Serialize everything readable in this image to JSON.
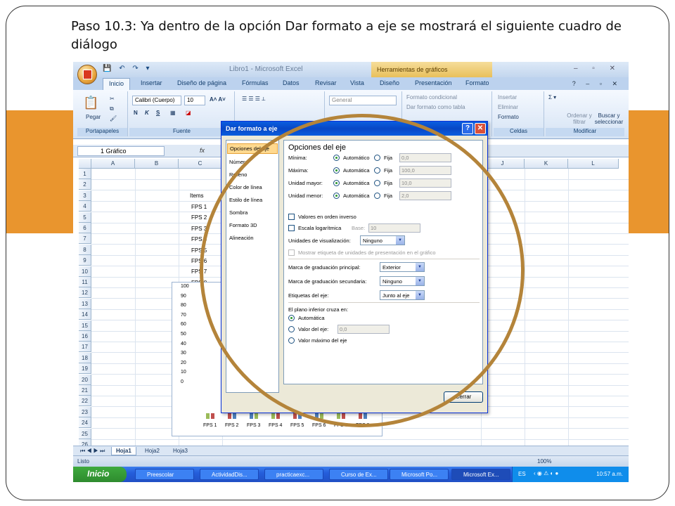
{
  "slide": {
    "title": "Paso 10.3: Ya dentro de la opción Dar formato a eje se mostrará el siguiente cuadro de diálogo",
    "accent_color": "#e9952e",
    "ring_color": "#b4843a"
  },
  "excel": {
    "window_title": "Libro1 - Microsoft Excel",
    "tools_tab": "Herramientas de gráficos",
    "tabs": [
      "Inicio",
      "Insertar",
      "Diseño de página",
      "Fórmulas",
      "Datos",
      "Revisar",
      "Vista",
      "Diseño",
      "Presentación",
      "Formato"
    ],
    "ribbon": {
      "font_name": "Calibri (Cuerpo)",
      "font_size": "10",
      "paste_label": "Pegar",
      "bold": "N",
      "italic": "K",
      "underline": "S",
      "number_format": "General",
      "cond_format": "Formato condicional",
      "table_format": "Dar formato como tabla",
      "insert": "Insertar",
      "delete": "Eliminar",
      "format": "Formato",
      "sort_filter": "Ordenar y filtrar",
      "find_select": "Buscar y seleccionar",
      "groups": [
        "Portapapeles",
        "Fuente",
        "Celdas",
        "Modificar"
      ]
    },
    "name_box": "1 Gráfico",
    "fx": "fx",
    "columns": [
      "A",
      "B",
      "C",
      "J",
      "K",
      "L"
    ],
    "rows": [
      "1",
      "2",
      "3",
      "4",
      "5",
      "6",
      "7",
      "8",
      "9",
      "10",
      "11",
      "12",
      "13",
      "14",
      "15",
      "16",
      "17",
      "18",
      "19",
      "20",
      "21",
      "22",
      "23",
      "24",
      "25",
      "26"
    ],
    "cells": {
      "items_header": "Items",
      "items": [
        "FPS 1",
        "FPS 2",
        "FPS 3",
        "FPS 4",
        "FPS 5",
        "FPS 6",
        "FPS 7",
        "FPS 8"
      ]
    },
    "chart": {
      "y_ticks": [
        "100",
        "90",
        "80",
        "70",
        "60",
        "50",
        "40",
        "30",
        "20",
        "10",
        "0"
      ],
      "x_labels": [
        "FPS 1",
        "FPS 2",
        "FPS 3",
        "FPS 4",
        "FPS 5",
        "FPS 6",
        "FPS 7",
        "FPS 8"
      ]
    },
    "sheets": [
      "Hoja1",
      "Hoja2",
      "Hoja3"
    ],
    "status": "Listo",
    "zoom": "100%"
  },
  "taskbar": {
    "start": "Inicio",
    "tasks": [
      "Preescolar",
      "ActividadDis...",
      "practicaexc...",
      "Curso de Ex...",
      "Microsoft Po...",
      "Microsoft Ex..."
    ],
    "lang": "ES",
    "time": "10:57 a.m."
  },
  "dialog": {
    "title": "Dar formato a eje",
    "categories": [
      "Opciones del eje",
      "Número",
      "Relleno",
      "Color de línea",
      "Estilo de línea",
      "Sombra",
      "Formato 3D",
      "Alineación"
    ],
    "heading": "Opciones del eje",
    "axis": [
      {
        "label": "Mínima:",
        "auto": "Automático",
        "fixed": "Fija",
        "value": "0,0"
      },
      {
        "label": "Máxima:",
        "auto": "Automática",
        "fixed": "Fija",
        "value": "100,0"
      },
      {
        "label": "Unidad mayor:",
        "auto": "Automática",
        "fixed": "Fija",
        "value": "10,0"
      },
      {
        "label": "Unidad menor:",
        "auto": "Automática",
        "fixed": "Fija",
        "value": "2,0"
      }
    ],
    "reverse_order": "Valores en orden inverso",
    "log_scale": "Escala logarítmica",
    "base_label": "Base:",
    "base_value": "10",
    "display_units_label": "Unidades de visualización:",
    "display_units_value": "Ninguno",
    "show_units_label": "Mostrar etiqueta de unidades de presentación en el gráfico",
    "major_tick_label": "Marca de graduación principal:",
    "major_tick_value": "Exterior",
    "minor_tick_label": "Marca de graduación secundaria:",
    "minor_tick_value": "Ninguno",
    "axis_labels_label": "Etiquetas del eje:",
    "axis_labels_value": "Junto al eje",
    "crosses_label": "El plano inferior cruza en:",
    "crosses_auto": "Automática",
    "crosses_value_label": "Valor del eje:",
    "crosses_value": "0,0",
    "crosses_max": "Valor máximo del eje",
    "close": "Cerrar"
  }
}
